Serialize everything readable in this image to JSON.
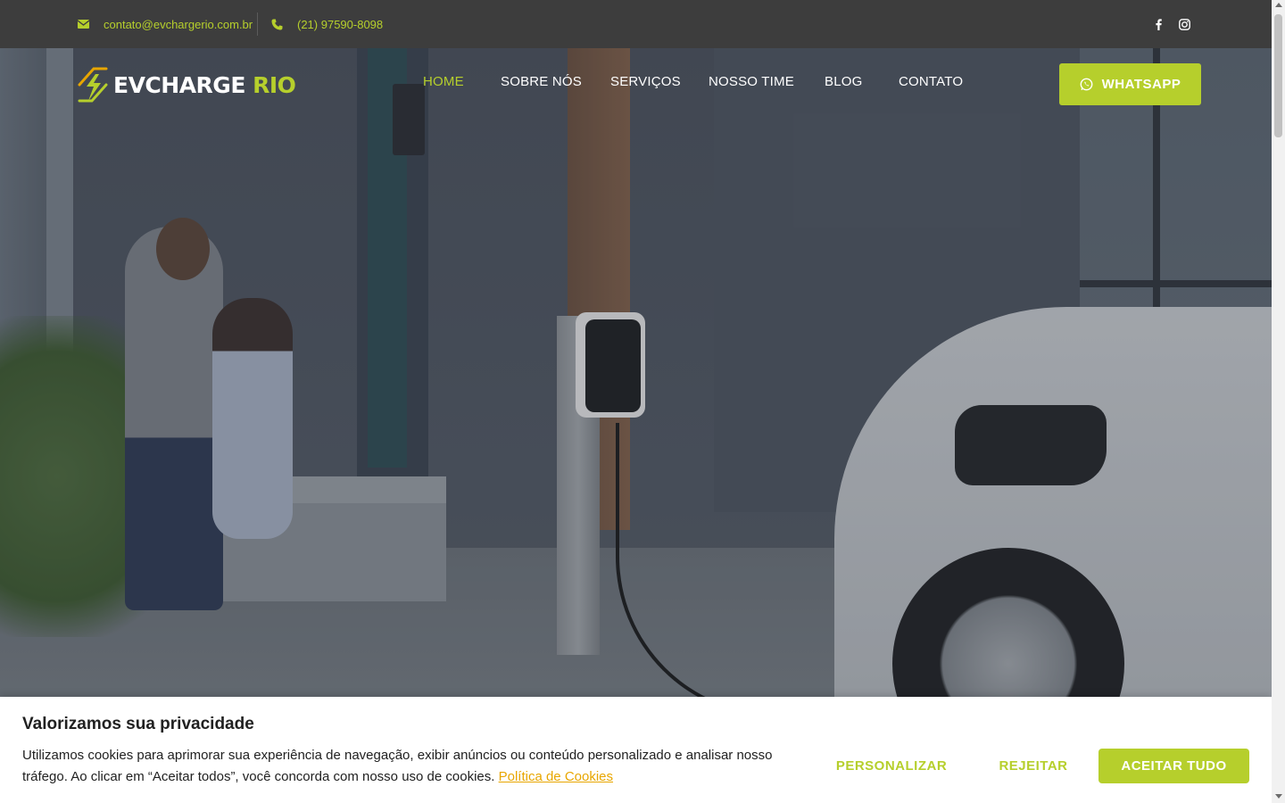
{
  "topbar": {
    "email": "contato@evchargerio.com.br",
    "phone": "(21) 97590-8098",
    "social": [
      "facebook-icon",
      "instagram-icon"
    ]
  },
  "logo": {
    "text_main": "EVCHARGE",
    "text_accent": "RIO"
  },
  "nav": {
    "items": [
      {
        "label": "HOME",
        "active": true
      },
      {
        "label": "SOBRE NÓS",
        "active": false
      },
      {
        "label": "SERVIÇOS",
        "active": false
      },
      {
        "label": "NOSSO TIME",
        "active": false
      },
      {
        "label": "BLOG",
        "active": false
      },
      {
        "label": "CONTATO",
        "active": false
      }
    ],
    "cta_label": "WHATSAPP"
  },
  "cookie": {
    "title": "Valorizamos sua privacidade",
    "body": "Utilizamos cookies para aprimorar sua experiência de navegação, exibir anúncios ou conteúdo personalizado e analisar nosso tráfego. Ao clicar em “Aceitar todos”, você concorda com nosso uso de cookies.",
    "policy_link": "Política de Cookies",
    "personalize_label": "PERSONALIZAR",
    "reject_label": "REJEITAR",
    "accept_label": "ACEITAR TUDO"
  },
  "colors": {
    "accent": "#b6cf2c",
    "topbar_bg": "#3d3d3d",
    "link_orange": "#e8a600",
    "text_dark": "#212121"
  }
}
